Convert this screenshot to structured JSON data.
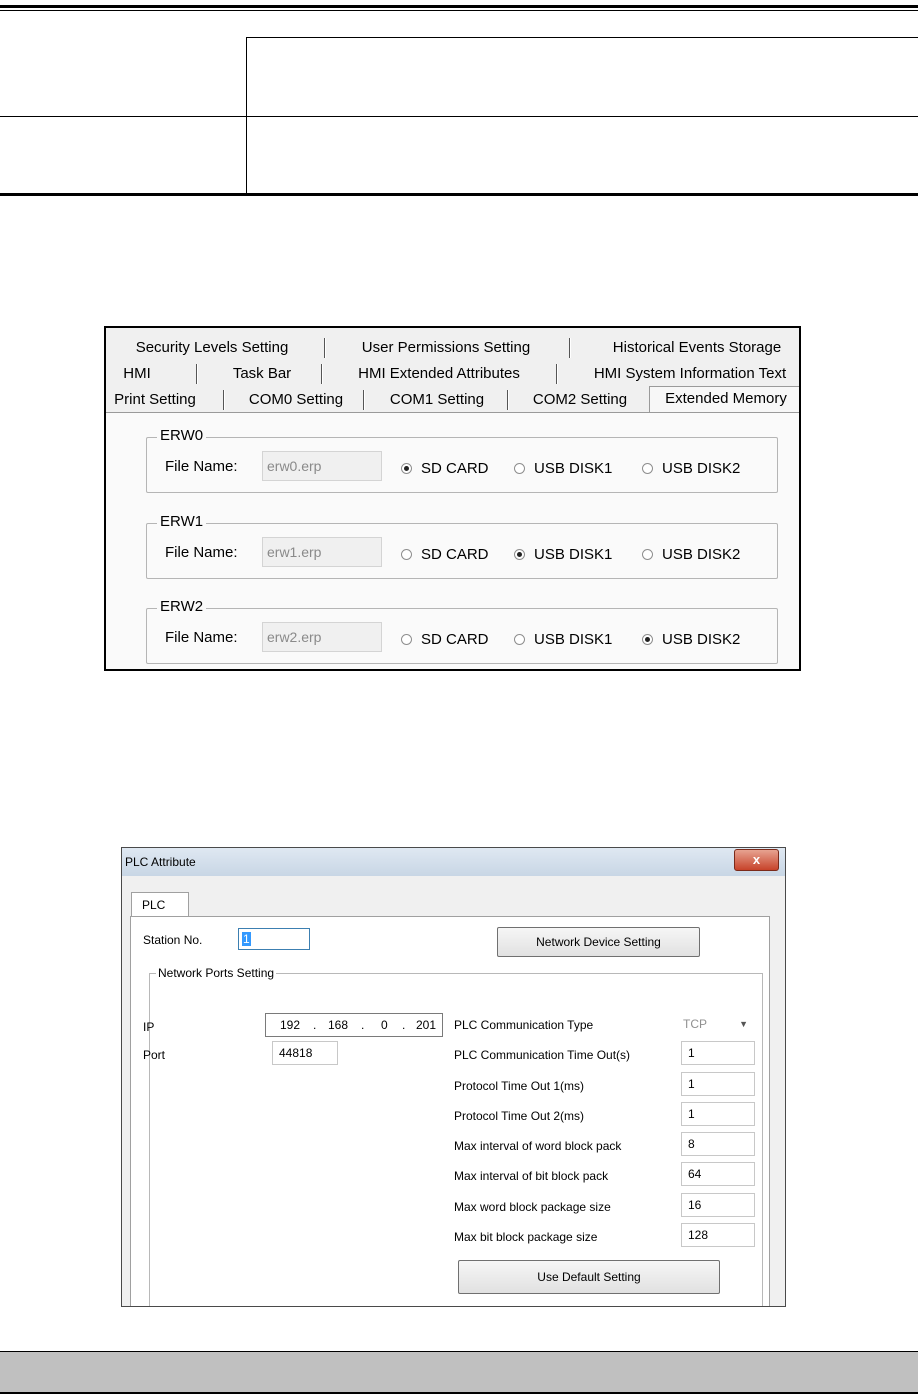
{
  "fig1": {
    "tab_rows": [
      [
        "Security Levels Setting",
        "User Permissions Setting",
        "Historical Events Storage"
      ],
      [
        "HMI",
        "Task Bar",
        "HMI Extended Attributes",
        "HMI System Information Text"
      ],
      [
        "Print Setting",
        "COM0 Setting",
        "COM1 Setting",
        "COM2 Setting",
        "Extended Memory"
      ]
    ],
    "active_tab": "Extended Memory",
    "file_name_label": "File Name:",
    "radio_labels": [
      "SD CARD",
      "USB DISK1",
      "USB DISK2"
    ],
    "groups": [
      {
        "title": "ERW0",
        "file_name": "erw0.erp",
        "selected": "SD CARD"
      },
      {
        "title": "ERW1",
        "file_name": "erw1.erp",
        "selected": "USB DISK1"
      },
      {
        "title": "ERW2",
        "file_name": "erw2.erp",
        "selected": "USB DISK2"
      }
    ]
  },
  "fig2": {
    "window_title": "PLC Attribute",
    "close_glyph": "x",
    "tab_label": "PLC",
    "station_label": "Station No.",
    "station_value": "1",
    "network_device_button": "Network Device Setting",
    "group_title": "Network Ports Setting",
    "ip_label": "IP",
    "ip_octets": [
      "192",
      "168",
      "0",
      "201"
    ],
    "ip_separator": ".",
    "port_label": "Port",
    "port_value": "44818",
    "comm_type_label": "PLC Communication Type",
    "comm_type_value": "TCP",
    "params": [
      {
        "label": "PLC Communication Time Out(s)",
        "value": "1"
      },
      {
        "label": "Protocol Time Out 1(ms)",
        "value": "1"
      },
      {
        "label": "Protocol Time Out 2(ms)",
        "value": "1"
      },
      {
        "label": "Max interval of word block pack",
        "value": "8"
      },
      {
        "label": "Max interval of bit block pack",
        "value": "64"
      },
      {
        "label": "Max word block package size",
        "value": "16"
      },
      {
        "label": "Max bit block package size",
        "value": "128"
      }
    ],
    "default_button": "Use Default Setting"
  }
}
